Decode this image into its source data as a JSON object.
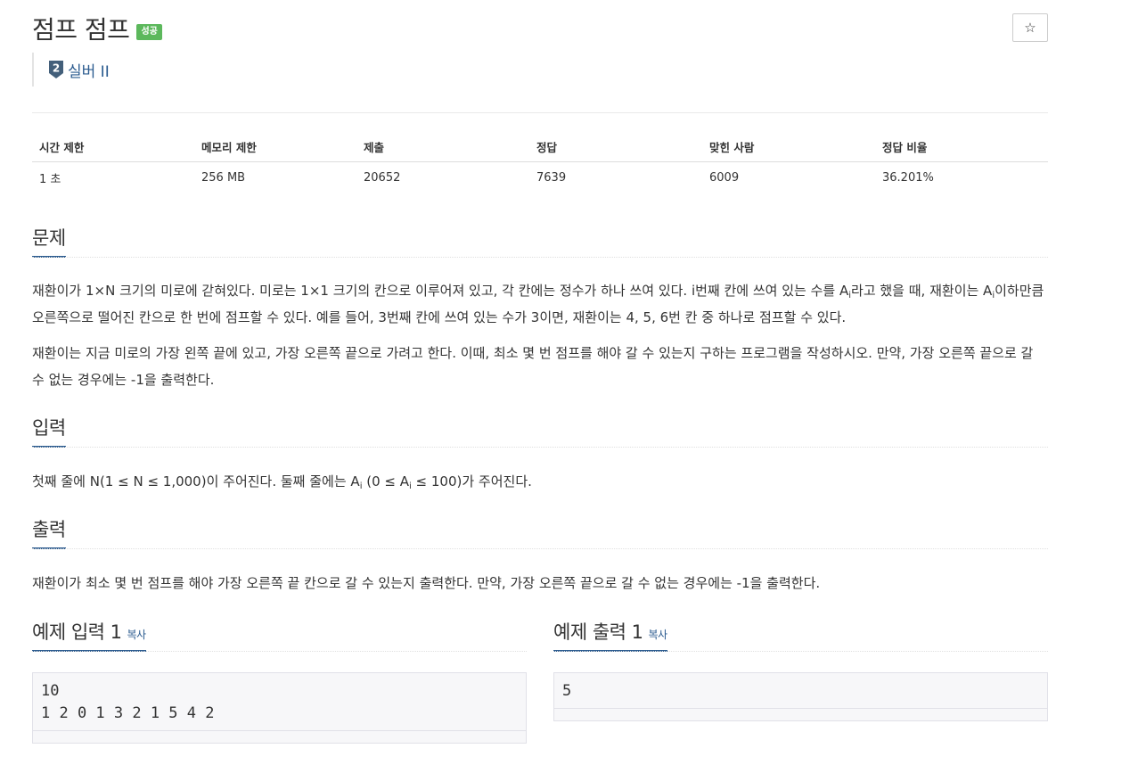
{
  "problem": {
    "title": "점프 점프",
    "result_badge": "성공",
    "star_glyph": "☆",
    "tier": {
      "number": "2",
      "label": "실버 II",
      "color": "#435f7a"
    }
  },
  "info_table": {
    "headers": [
      "시간 제한",
      "메모리 제한",
      "제출",
      "정답",
      "맞힌 사람",
      "정답 비율"
    ],
    "values": [
      "1 초",
      "256 MB",
      "20652",
      "7639",
      "6009",
      "36.201%"
    ]
  },
  "sections": {
    "description": {
      "title": "문제",
      "p1_a": "재환이가 1×N 크기의 미로에 갇혀있다. 미로는 1×1 크기의 칸으로 이루어져 있고, 각 칸에는 정수가 하나 쓰여 있다. i번째 칸에 쓰여 있는 수를 A",
      "p1_sub1": "i",
      "p1_b": "라고 했을 때, 재환이는 A",
      "p1_sub2": "i",
      "p1_c": "이하만큼 오른쪽으로 떨어진 칸으로 한 번에 점프할 수 있다. 예를 들어, 3번째 칸에 쓰여 있는 수가 3이면, 재환이는 4, 5, 6번 칸 중 하나로 점프할 수 있다.",
      "p2": "재환이는 지금 미로의 가장 왼쪽 끝에 있고, 가장 오른쪽 끝으로 가려고 한다. 이때, 최소 몇 번 점프를 해야 갈 수 있는지 구하는 프로그램을 작성하시오. 만약, 가장 오른쪽 끝으로 갈 수 없는 경우에는 -1을 출력한다."
    },
    "input": {
      "title": "입력",
      "p_a": "첫째 줄에 N(1 ≤ N ≤ 1,000)이 주어진다. 둘째 줄에는 A",
      "p_sub1": "i",
      "p_b": " (0 ≤ A",
      "p_sub2": "i",
      "p_c": " ≤ 100)가 주어진다."
    },
    "output": {
      "title": "출력",
      "p": "재환이가 최소 몇 번 점프를 해야 가장 오른쪽 끝 칸으로 갈 수 있는지 출력한다. 만약, 가장 오른쪽 끝으로 갈 수 없는 경우에는 -1을 출력한다."
    }
  },
  "samples": {
    "input": {
      "title": "예제 입력 1",
      "copy_label": "복사",
      "text": "10\n1 2 0 1 3 2 1 5 4 2"
    },
    "output": {
      "title": "예제 출력 1",
      "copy_label": "복사",
      "text": "5"
    }
  }
}
